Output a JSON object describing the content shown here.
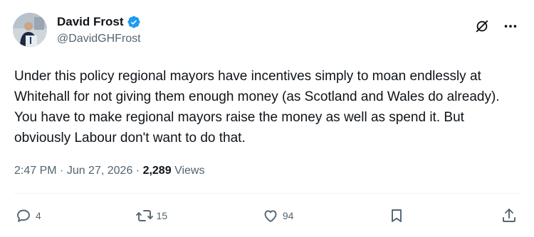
{
  "author": {
    "display_name": "David Frost",
    "handle": "@DavidGHFrost",
    "verified": true,
    "verified_badge_color": "#1d9bf0"
  },
  "header_icons": [
    "grok-icon",
    "more-options-icon"
  ],
  "post": {
    "text": "Under this policy regional mayors have incentives simply to moan endlessly at Whitehall for not giving them enough money (as Scotland and Wales do already).  You have to make regional mayors raise the money as well as spend it. But obviously Labour don't want to do that."
  },
  "meta": {
    "time": "2:47 PM",
    "separator": " · ",
    "date": "Jun 27, 2026",
    "views_count": "2,289",
    "views_label": "Views"
  },
  "actions": {
    "reply_count": "4",
    "repost_count": "15",
    "like_count": "94"
  },
  "colors": {
    "text_primary": "#0f1419",
    "text_secondary": "#536471",
    "divider": "#eff3f4"
  }
}
